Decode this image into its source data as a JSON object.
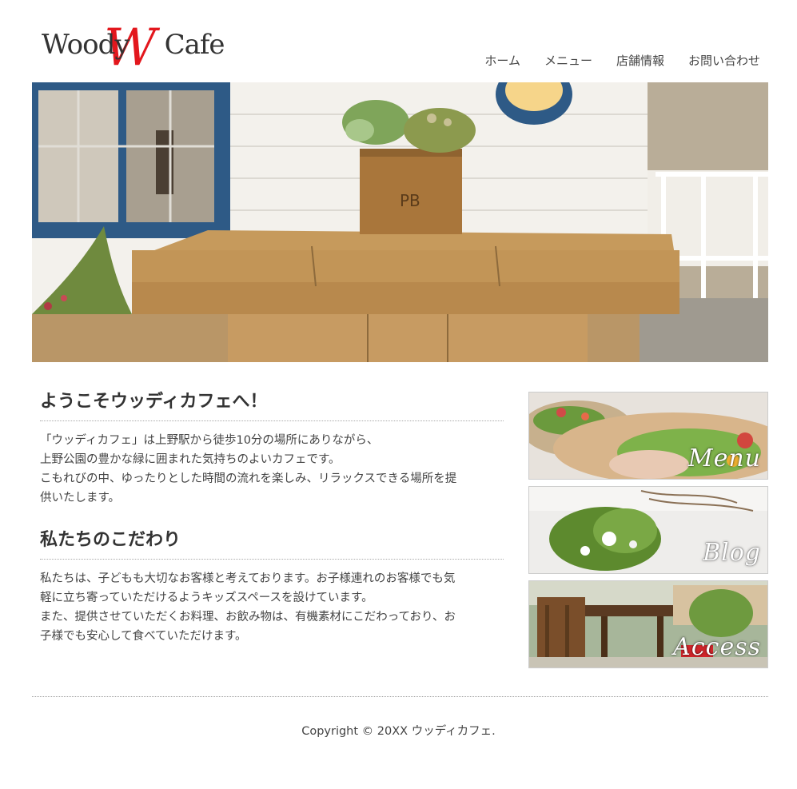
{
  "logo": {
    "text_left": "Woody",
    "text_w": "W",
    "text_right": "Cafe",
    "accent": "#e3171d"
  },
  "nav": [
    "ホーム",
    "メニュー",
    "店舗情報",
    "お問い合わせ"
  ],
  "main": {
    "welcome_title": "ようこそウッディカフェへ！",
    "welcome_lines": [
      "「ウッディカフェ」は上野駅から徒歩10分の場所にありながら、",
      "上野公園の豊かな緑に囲まれた気持ちのよいカフェです。",
      "こもれびの中、ゆったりとした時間の流れを楽しみ、リラックスできる場所を提",
      "供いたします。"
    ],
    "commit_title": "私たちのこだわり",
    "commit_lines": [
      "私たちは、子どもも大切なお客様と考えております。お子様連れのお客様でも気",
      "軽に立ち寄っていただけるようキッズスペースを設けています。",
      "また、提供させていただくお料理、お飲み物は、有機素材にこだわっており、お",
      "子様でも安心して食べていただけます。"
    ]
  },
  "banners": [
    {
      "label": "Menu"
    },
    {
      "label": "Blog"
    },
    {
      "label": "Access"
    }
  ],
  "footer": {
    "copyright": "Copyright © 20XX ウッディカフェ."
  }
}
